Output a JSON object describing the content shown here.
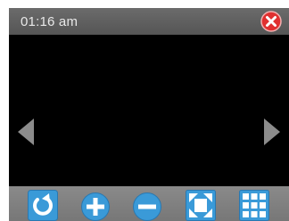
{
  "header": {
    "time": "01:16 am",
    "close_icon": "close-icon"
  },
  "navigation": {
    "previous_icon": "arrow-left-icon",
    "next_icon": "arrow-right-icon"
  },
  "toolbar": {
    "buttons": [
      {
        "icon": "rotate-icon"
      },
      {
        "icon": "zoom-in-icon"
      },
      {
        "icon": "zoom-out-icon"
      },
      {
        "icon": "fit-to-screen-icon"
      },
      {
        "icon": "grid-view-icon"
      }
    ]
  },
  "colors": {
    "title_bar": "#5f5f5f",
    "toolbar": "#808080",
    "viewport": "#000000",
    "close_red": "#e03030",
    "icon_fill": "#3a9ad8",
    "arrow_gray": "#8c8c8c"
  }
}
